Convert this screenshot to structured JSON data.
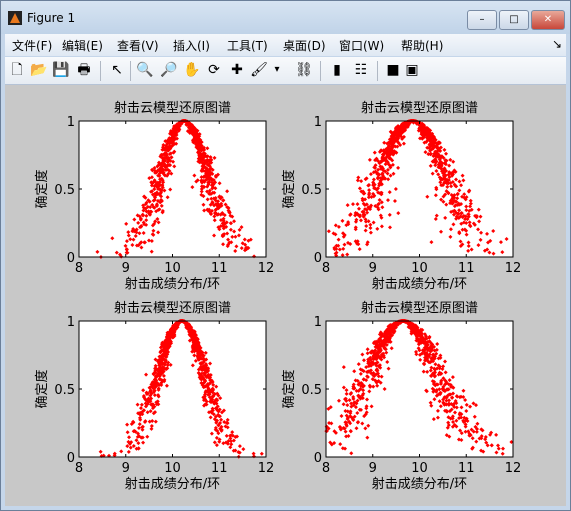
{
  "window": {
    "title": "Figure 1",
    "min": "–",
    "max": "□",
    "close": "✕"
  },
  "menu": [
    "文件(F)",
    "编辑(E)",
    "查看(V)",
    "插入(I)",
    "工具(T)",
    "桌面(D)",
    "窗口(W)",
    "帮助(H)"
  ],
  "menu_overflow": "↘",
  "toolbar": [
    {
      "icon": "new-file-icon",
      "glyph": "🗋"
    },
    {
      "icon": "open-folder-icon",
      "glyph": "📂"
    },
    {
      "icon": "save-icon",
      "glyph": "💾"
    },
    {
      "icon": "print-icon",
      "glyph": "🖶"
    },
    {
      "icon": "pointer-icon",
      "glyph": "↖"
    },
    {
      "icon": "zoom-in-icon",
      "glyph": "🔍"
    },
    {
      "icon": "zoom-out-icon",
      "glyph": "🔎"
    },
    {
      "icon": "pan-icon",
      "glyph": "✋"
    },
    {
      "icon": "rotate-icon",
      "glyph": "⟳"
    },
    {
      "icon": "data-cursor-icon",
      "glyph": "✚"
    },
    {
      "icon": "brush-icon",
      "glyph": "🖌"
    },
    {
      "icon": "dropdown-icon",
      "glyph": "▾"
    },
    {
      "icon": "link-icon",
      "glyph": "⛓"
    },
    {
      "icon": "colorbar-icon",
      "glyph": "▮"
    },
    {
      "icon": "legend-icon",
      "glyph": "☷"
    },
    {
      "icon": "hide-plot-tools-icon",
      "glyph": "■"
    },
    {
      "icon": "show-plot-tools-icon",
      "glyph": "▣"
    }
  ],
  "colors": {
    "marker": "#ff0000",
    "figure_bg": "#c8c8c8"
  },
  "chart_data": [
    {
      "type": "scatter",
      "title": "射击云模型还原图谱",
      "xlabel": "射击成绩分布/环",
      "ylabel": "确定度",
      "xlim": [
        8,
        12
      ],
      "ylim": [
        0,
        1
      ],
      "xticks": [
        "8",
        "9",
        "10",
        "11",
        "12"
      ],
      "yticks": [
        "0",
        "0.5",
        "1"
      ],
      "grid": false,
      "marker": "diamond",
      "cloud": {
        "Ex": 10.25,
        "En": 0.5,
        "He": 0.1,
        "n": 1000
      }
    },
    {
      "type": "scatter",
      "title": "射击云模型还原图谱",
      "xlabel": "射击成绩分布/环",
      "ylabel": "确定度",
      "xlim": [
        8,
        12
      ],
      "ylim": [
        0,
        1
      ],
      "xticks": [
        "8",
        "9",
        "10",
        "11",
        "12"
      ],
      "yticks": [
        "0",
        "0.5",
        "1"
      ],
      "grid": false,
      "marker": "diamond",
      "cloud": {
        "Ex": 9.85,
        "En": 0.7,
        "He": 0.15,
        "n": 1000
      }
    },
    {
      "type": "scatter",
      "title": "射击云模型还原图谱",
      "xlabel": "射击成绩分布/环",
      "ylabel": "确定度",
      "xlim": [
        8,
        12
      ],
      "ylim": [
        0,
        1
      ],
      "xticks": [
        "8",
        "9",
        "10",
        "11",
        "12"
      ],
      "yticks": [
        "0",
        "0.5",
        "1"
      ],
      "grid": false,
      "marker": "diamond",
      "cloud": {
        "Ex": 10.2,
        "En": 0.5,
        "He": 0.08,
        "n": 1000
      }
    },
    {
      "type": "scatter",
      "title": "射击云模型还原图谱",
      "xlabel": "射击成绩分布/环",
      "ylabel": "确定度",
      "xlim": [
        8,
        12
      ],
      "ylim": [
        0,
        1
      ],
      "xticks": [
        "8",
        "9",
        "10",
        "11",
        "12"
      ],
      "yticks": [
        "0",
        "0.5",
        "1"
      ],
      "grid": false,
      "marker": "diamond",
      "cloud": {
        "Ex": 9.65,
        "En": 0.75,
        "He": 0.15,
        "n": 1000
      }
    }
  ]
}
